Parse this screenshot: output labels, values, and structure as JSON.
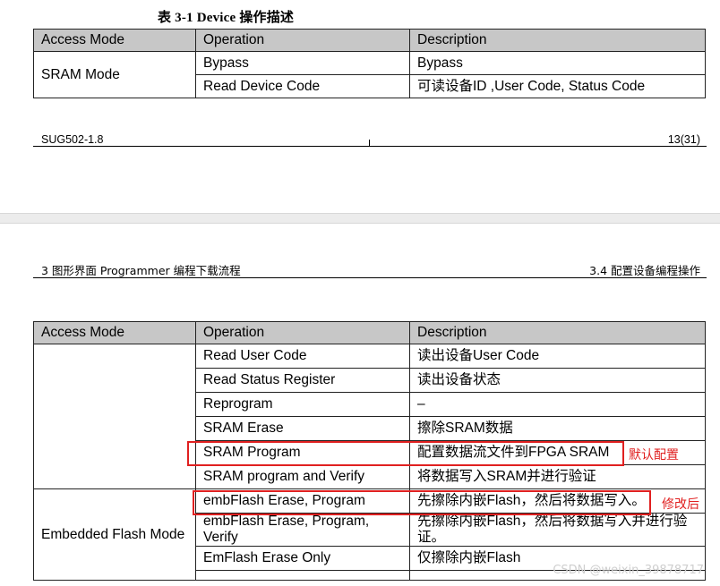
{
  "table1": {
    "caption": "表 3-1 Device 操作描述",
    "headers": [
      "Access Mode",
      "Operation",
      "Description"
    ],
    "mode": "SRAM Mode",
    "rows": [
      {
        "op": "Bypass",
        "desc": "Bypass"
      },
      {
        "op": "Read Device Code",
        "desc": "可读设备ID ,User Code, Status Code"
      }
    ]
  },
  "footer": {
    "doc_id": "SUG502-1.8",
    "page": "13(31)"
  },
  "page_header": {
    "left": "3  图形界面 Programmer 编程下载流程",
    "right": "3.4  配置设备编程操作"
  },
  "table2": {
    "headers": [
      "Access Mode",
      "Operation",
      "Description"
    ],
    "rows": [
      {
        "op": "Read User Code",
        "desc": "读出设备User Code"
      },
      {
        "op": "Read Status Register",
        "desc": "读出设备状态"
      },
      {
        "op": "Reprogram",
        "desc": "–"
      },
      {
        "op": "SRAM Erase",
        "desc": "擦除SRAM数据"
      },
      {
        "op": "SRAM Program",
        "desc": "配置数据流文件到FPGA SRAM"
      },
      {
        "op": "SRAM program and Verify",
        "desc": "将数据写入SRAM并进行验证"
      }
    ],
    "flash_mode": "Embedded Flash Mode",
    "flash_rows": [
      {
        "op": "embFlash Erase, Program",
        "desc": "先擦除内嵌Flash，然后将数据写入。"
      },
      {
        "op": "embFlash Erase, Program, Verify",
        "desc": "先擦除内嵌Flash，然后将数据写入并进行验证。"
      },
      {
        "op": "EmFlash Erase Only",
        "desc": "仅擦除内嵌Flash"
      }
    ]
  },
  "annotations": {
    "default_note": "默认配置",
    "modified_note": "修改后"
  },
  "watermark": "CSDN @weixin_39878717",
  "colors": {
    "header_bg": "#c7c7c7",
    "annotation_red": "#e02020"
  }
}
